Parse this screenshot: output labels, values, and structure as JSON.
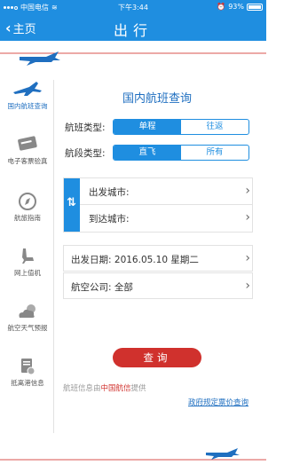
{
  "status_bar": {
    "carrier": "中国电信",
    "time": "下午3:44",
    "battery": "93%"
  },
  "nav": {
    "back_label": "主页",
    "title": "出行"
  },
  "sidebar": {
    "items": [
      {
        "label": "国内航班查询",
        "icon": "airplane-icon",
        "active": true
      },
      {
        "label": "电子客票验真",
        "icon": "ticket-icon",
        "active": false
      },
      {
        "label": "航旅指南",
        "icon": "compass-icon",
        "active": false
      },
      {
        "label": "网上值机",
        "icon": "seat-icon",
        "active": false
      },
      {
        "label": "航空天气预报",
        "icon": "weather-icon",
        "active": false
      },
      {
        "label": "抵离港信息",
        "icon": "document-clock-icon",
        "active": false
      }
    ]
  },
  "form": {
    "title": "国内航班查询",
    "flight_type_label": "航班类型:",
    "flight_type_options": [
      "单程",
      "往返"
    ],
    "flight_type_selected": "单程",
    "segment_type_label": "航段类型:",
    "segment_type_options": [
      "直飞",
      "所有"
    ],
    "segment_type_selected": "直飞",
    "departure_city_label": "出发城市:",
    "arrival_city_label": "到达城市:",
    "date_label": "出发日期:",
    "date_value": "2016.05.10 星期二",
    "airline_label": "航空公司:",
    "airline_value": "全部",
    "query_button": "查询",
    "provider_prefix": "航班信息由",
    "provider_name": "中国航信",
    "provider_suffix": "提供",
    "policy_link": "政府规定票价查询"
  },
  "colors": {
    "primary": "#1f8ee0",
    "accent_red": "#d0312d",
    "link": "#1f6fc0"
  }
}
